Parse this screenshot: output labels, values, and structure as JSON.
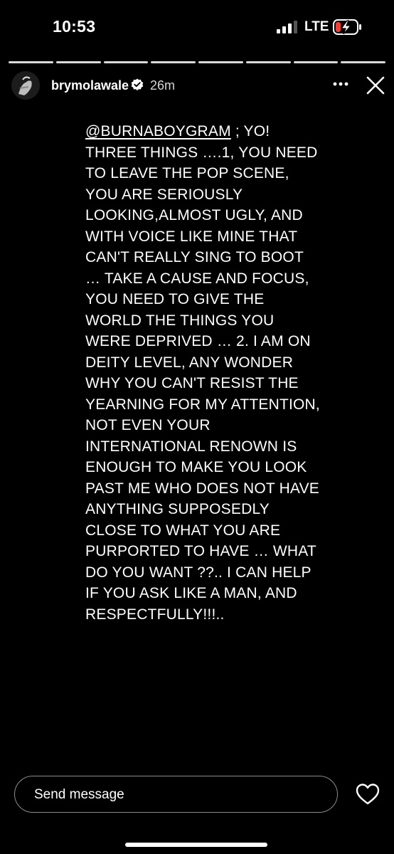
{
  "status_bar": {
    "time": "10:53",
    "network": "LTE",
    "signal_icon": "cellular-signal-icon",
    "battery_icon": "battery-charging-icon",
    "battery_color": "#ff3b30"
  },
  "story": {
    "segments_total": 8,
    "segments_viewed": 8,
    "username": "brymolawale",
    "verified": true,
    "time_ago": "26m",
    "mention": "@BURNABOYGRAM",
    "body": " ; YO! THREE THINGS ….1, YOU NEED TO LEAVE THE POP SCENE, YOU ARE SERIOUSLY LOOKING,ALMOST UGLY, AND WITH VOICE LIKE MINE THAT CAN'T REALLY SING TO BOOT … TAKE A CAUSE AND FOCUS, YOU NEED TO GIVE THE WORLD THE THINGS YOU WERE DEPRIVED … 2. I AM ON DEITY LEVEL, ANY WONDER WHY YOU CAN'T RESIST THE YEARNING FOR MY ATTENTION, NOT EVEN YOUR INTERNATIONAL RENOWN IS ENOUGH TO MAKE YOU LOOK PAST ME WHO DOES NOT HAVE ANYTHING SUPPOSEDLY CLOSE TO WHAT YOU ARE PURPORTED TO HAVE … WHAT DO YOU WANT ??.. I CAN HELP IF YOU ASK LIKE A MAN, AND RESPECTFULLY!!!.."
  },
  "footer": {
    "message_placeholder": "Send message"
  }
}
